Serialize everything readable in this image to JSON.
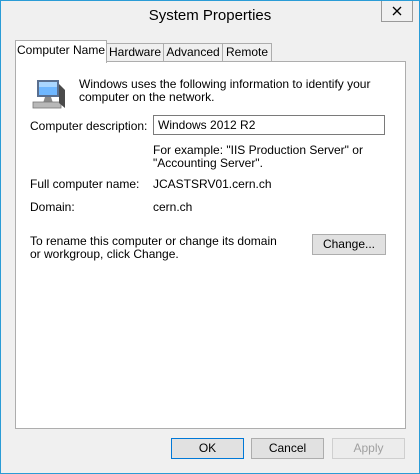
{
  "window": {
    "title": "System Properties"
  },
  "tabs": [
    {
      "label": "Computer Name",
      "active": true
    },
    {
      "label": "Hardware",
      "active": false
    },
    {
      "label": "Advanced",
      "active": false
    },
    {
      "label": "Remote",
      "active": false
    }
  ],
  "computer_name": {
    "intro": "Windows uses the following information to identify your computer on the network.",
    "description_label": "Computer description:",
    "description_value": "Windows 2012 R2",
    "example_text": "For example: \"IIS Production Server\" or \"Accounting Server\".",
    "full_name_label": "Full computer name:",
    "full_name_value": "JCASTSRV01.cern.ch",
    "domain_label": "Domain:",
    "domain_value": "cern.ch",
    "rename_text": "To rename this computer or change its domain or workgroup, click Change.",
    "change_button": "Change..."
  },
  "footer": {
    "ok": "OK",
    "cancel": "Cancel",
    "apply": "Apply"
  },
  "colors": {
    "window_border": "#2a9cd6",
    "focus_border": "#0078d7"
  }
}
